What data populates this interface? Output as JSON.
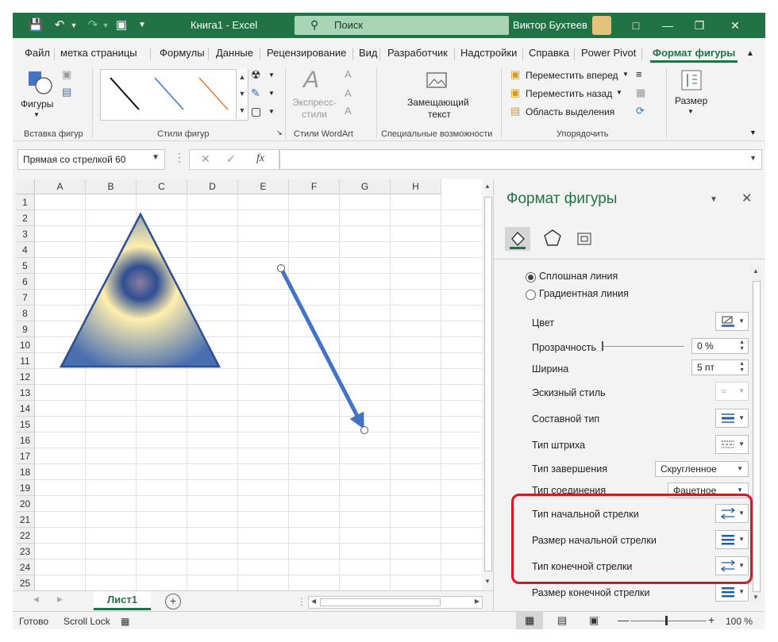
{
  "titlebar": {
    "title": "Книга1  -  Excel",
    "search_label": "Поиск",
    "user_name": "Виктор Бухтеев",
    "icons": [
      "save-icon",
      "undo-icon",
      "redo-icon",
      "camera-icon",
      "customize-icon"
    ]
  },
  "tabs": [
    "Файл",
    "метка страницы",
    "Формулы",
    "Данные",
    "Рецензирование",
    "Вид",
    "Разработчик",
    "Надстройки",
    "Справка",
    "Power Pivot",
    "Формат фигуры"
  ],
  "ribbon": {
    "groups": {
      "insert_shapes": "Вставка фигур",
      "shape_styles": "Стили фигур",
      "wordart": "Стили WordArt",
      "special": "Специальные возможности",
      "arrange": "Упорядочить"
    },
    "shapes_label": "Фигуры",
    "express_styles_line1": "Экспресс-",
    "express_styles_line2": "стили",
    "alt_text_line1": "Замещающий",
    "alt_text_line2": "текст",
    "bring_forward": "Переместить вперед",
    "send_backward": "Переместить назад",
    "selection_pane": "Область выделения",
    "size_label": "Размер"
  },
  "formula_bar": {
    "name_box": "Прямая со стрелкой 60",
    "fx": "fx"
  },
  "grid": {
    "columns": [
      "A",
      "B",
      "C",
      "D",
      "E",
      "F",
      "G",
      "H"
    ],
    "rows": [
      "1",
      "2",
      "3",
      "4",
      "5",
      "6",
      "7",
      "8",
      "9",
      "10",
      "11",
      "12",
      "13",
      "14",
      "15",
      "16",
      "17",
      "18",
      "19",
      "20",
      "21",
      "22",
      "23",
      "24",
      "25"
    ]
  },
  "sheets": {
    "active": "Лист1"
  },
  "status": {
    "ready": "Готово",
    "scroll_lock": "Scroll Lock",
    "zoom": "100 %"
  },
  "pane": {
    "title": "Формат фигуры",
    "solid_line": "Сплошная линия",
    "gradient_line": "Градиентная линия",
    "color": "Цвет",
    "transparency": "Прозрачность",
    "transparency_value": "0 %",
    "width": "Ширина",
    "width_value": "5 пт",
    "sketch_style": "Эскизный стиль",
    "compound_type": "Составной тип",
    "dash_type": "Тип штриха",
    "cap_type": "Тип завершения",
    "cap_value": "Скругленное",
    "join_type": "Тип соединения",
    "join_value": "Фацетное",
    "begin_arrow_type": "Тип начальной стрелки",
    "begin_arrow_size": "Размер начальной стрелки",
    "end_arrow_type": "Тип конечной стрелки",
    "end_arrow_size": "Размер конечной стрелки"
  },
  "colors": {
    "accent": "#217346",
    "highlight": "#e0141e",
    "shape_blue": "#4472c4"
  }
}
